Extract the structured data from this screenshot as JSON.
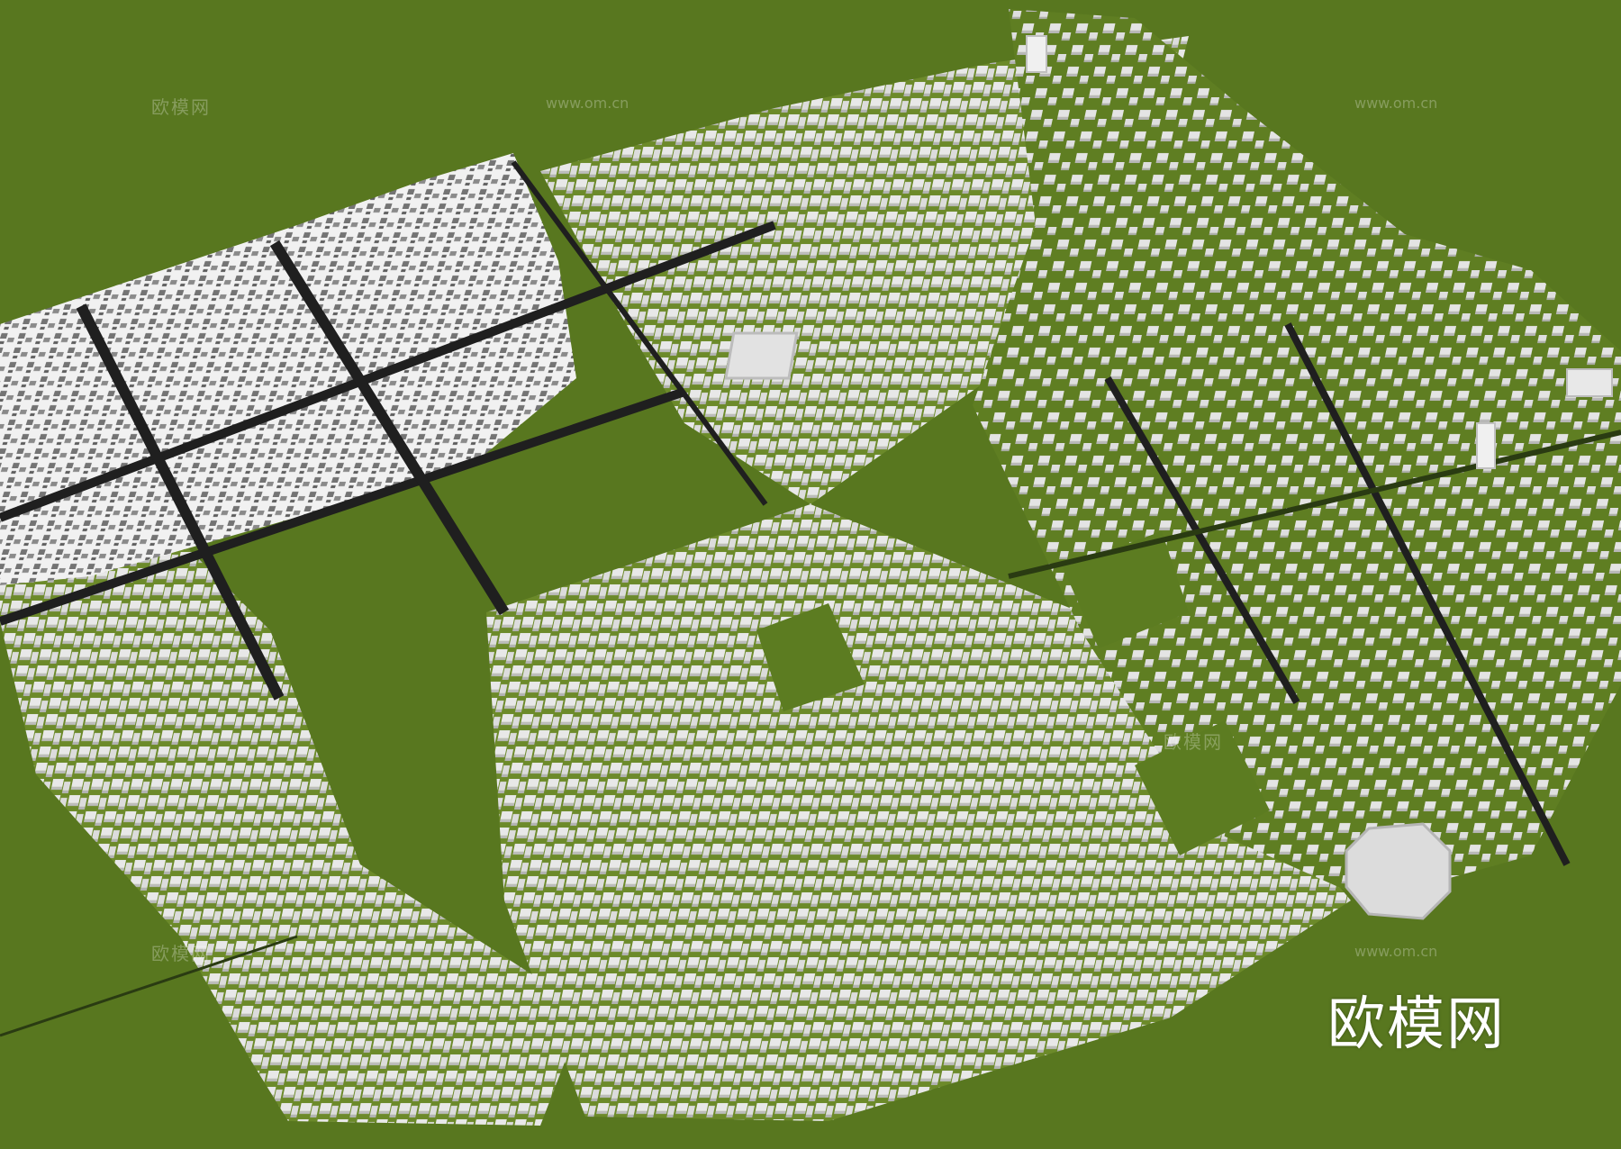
{
  "watermark": {
    "brand": "欧模网",
    "url": "www.om.cn"
  },
  "colors": {
    "grass": "#58771f",
    "building_light": "#e6e6e6",
    "building_shade": "#c2c2c2",
    "building_dark": "#7a7a7a",
    "road": "#1f1f1f"
  }
}
